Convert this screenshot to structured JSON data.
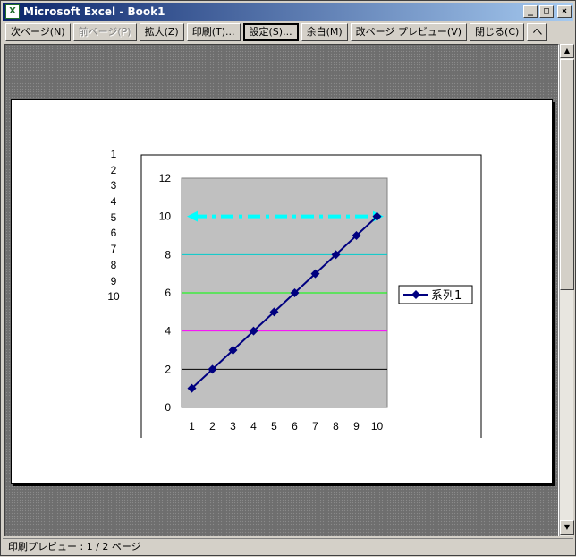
{
  "window": {
    "title": "Microsoft Excel - Book1",
    "app_icon": "excel-icon",
    "minimize_glyph": "_",
    "maximize_glyph": "□",
    "close_glyph": "×"
  },
  "toolbar": {
    "next_page": "次ページ(N)",
    "prev_page": "前ページ(P)",
    "zoom": "拡大(Z)",
    "print": "印刷(T)...",
    "setup": "設定(S)...",
    "margins": "余白(M)",
    "page_break_preview": "改ページ プレビュー(V)",
    "close": "閉じる(C)",
    "help": "ヘ"
  },
  "sheet": {
    "row_values": [
      "1",
      "2",
      "3",
      "4",
      "5",
      "6",
      "7",
      "8",
      "9",
      "10"
    ]
  },
  "chart_data": {
    "type": "line",
    "x": [
      1,
      2,
      3,
      4,
      5,
      6,
      7,
      8,
      9,
      10
    ],
    "series": [
      {
        "name": "系列1",
        "values": [
          1,
          2,
          3,
          4,
          5,
          6,
          7,
          8,
          9,
          10
        ],
        "color": "#000080",
        "marker": "diamond"
      }
    ],
    "x_tick_labels": [
      "1",
      "2",
      "3",
      "4",
      "5",
      "6",
      "7",
      "8",
      "9",
      "10"
    ],
    "y_tick_labels": [
      "0",
      "2",
      "4",
      "6",
      "8",
      "10",
      "12"
    ],
    "ylim": [
      0,
      12
    ],
    "reference_lines": [
      {
        "y": 2,
        "color": "#000000"
      },
      {
        "y": 4,
        "color": "#ff00ff"
      },
      {
        "y": 6,
        "color": "#00ff00"
      },
      {
        "y": 8,
        "color": "#00cccc"
      },
      {
        "y": 10,
        "color": "#00ffff",
        "style": "dash-dot",
        "arrows": "both"
      }
    ],
    "plot_background": "#c0c0c0",
    "legend_position": "right"
  },
  "status": {
    "text": "印刷プレビュー : 1 / 2 ページ"
  }
}
